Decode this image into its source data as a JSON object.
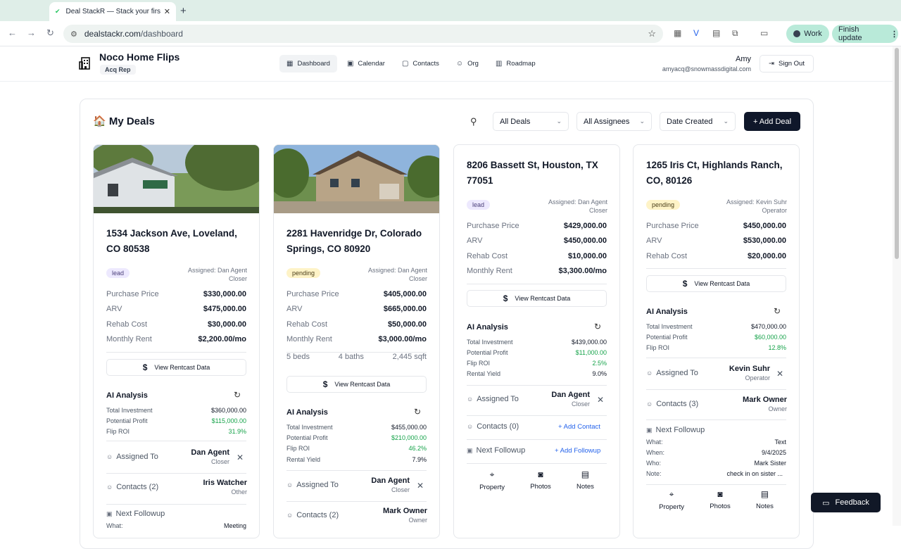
{
  "browser": {
    "tab_title": "Deal StackR — Stack your firs",
    "url_host": "dealstackr.com",
    "url_path": "/dashboard",
    "profile_label": "Work",
    "update_label": "Finish update"
  },
  "app": {
    "company": "Noco Home Flips",
    "role": "Acq Rep",
    "nav": [
      "Dashboard",
      "Calendar",
      "Contacts",
      "Org",
      "Roadmap"
    ],
    "user_name": "Amy",
    "user_email": "amyacq@snowmassdigital.com",
    "sign_out": "Sign Out"
  },
  "deals_header": {
    "title": "🏠 My Deals",
    "filter_deals": "All Deals",
    "filter_assignees": "All Assignees",
    "sort": "Date Created",
    "add_deal": "+ Add Deal"
  },
  "labels": {
    "purchase_price": "Purchase Price",
    "arv": "ARV",
    "rehab_cost": "Rehab Cost",
    "monthly_rent": "Monthly Rent",
    "view_rentcast": "View Rentcast Data",
    "ai_analysis": "AI Analysis",
    "total_investment": "Total Investment",
    "potential_profit": "Potential Profit",
    "flip_roi": "Flip ROI",
    "rental_yield": "Rental Yield",
    "assigned_to": "Assigned To",
    "next_followup": "Next Followup",
    "add_contact": "+ Add Contact",
    "add_followup": "+ Add Followup",
    "what": "What:",
    "when": "When:",
    "who": "Who:",
    "note": "Note:",
    "property": "Property",
    "photos": "Photos",
    "notes": "Notes",
    "feedback": "Feedback"
  },
  "cards": [
    {
      "address": "1534 Jackson Ave, Loveland, CO 80538",
      "status": "lead",
      "assigned_line1": "Assigned: Dan Agent",
      "assigned_line2": "Closer",
      "purchase_price": "$330,000.00",
      "arv": "$475,000.00",
      "rehab_cost": "$30,000.00",
      "monthly_rent": "$2,200.00/mo",
      "total_investment": "$360,000.00",
      "potential_profit": "$115,000.00",
      "flip_roi": "31.9%",
      "assignee_name": "Dan Agent",
      "assignee_role": "Closer",
      "contacts_label": "Contacts (2)",
      "contact_name": "Iris Watcher",
      "contact_role": "Other",
      "followup_what": "Meeting"
    },
    {
      "address": "2281 Havenridge Dr, Colorado Springs, CO 80920",
      "status": "pending",
      "assigned_line1": "Assigned: Dan Agent",
      "assigned_line2": "Closer",
      "purchase_price": "$405,000.00",
      "arv": "$665,000.00",
      "rehab_cost": "$50,000.00",
      "monthly_rent": "$3,000.00/mo",
      "beds": "5 beds",
      "baths": "4 baths",
      "sqft": "2,445 sqft",
      "total_investment": "$455,000.00",
      "potential_profit": "$210,000.00",
      "flip_roi": "46.2%",
      "rental_yield": "7.9%",
      "assignee_name": "Dan Agent",
      "assignee_role": "Closer",
      "contacts_label": "Contacts (2)",
      "contact_name": "Mark Owner",
      "contact_role": "Owner"
    },
    {
      "address": "8206 Bassett St, Houston, TX 77051",
      "status": "lead",
      "assigned_line1": "Assigned: Dan Agent",
      "assigned_line2": "Closer",
      "purchase_price": "$429,000.00",
      "arv": "$450,000.00",
      "rehab_cost": "$10,000.00",
      "monthly_rent": "$3,300.00/mo",
      "total_investment": "$439,000.00",
      "potential_profit": "$11,000.00",
      "flip_roi": "2.5%",
      "rental_yield": "9.0%",
      "assignee_name": "Dan Agent",
      "assignee_role": "Closer",
      "contacts_label": "Contacts (0)"
    },
    {
      "address": "1265 Iris Ct, Highlands Ranch, CO, 80126",
      "status": "pending",
      "assigned_line1": "Assigned: Kevin Suhr",
      "assigned_line2": "Operator",
      "purchase_price": "$450,000.00",
      "arv": "$530,000.00",
      "rehab_cost": "$20,000.00",
      "total_investment": "$470,000.00",
      "potential_profit": "$60,000.00",
      "flip_roi": "12.8%",
      "assignee_name": "Kevin Suhr",
      "assignee_role": "Operator",
      "contacts_label": "Contacts (3)",
      "contact_name": "Mark Owner",
      "contact_role": "Owner",
      "followup_what": "Text",
      "followup_when": "9/4/2025",
      "followup_who": "Mark Sister",
      "followup_note": "check in on sister ..."
    }
  ],
  "icons": {
    "favicon": "check-icon",
    "company_logo": "building-icon",
    "dashboard": "grid-icon",
    "calendar": "calendar-icon",
    "contacts": "contact-card-icon",
    "org": "users-icon",
    "roadmap": "map-icon",
    "sign_out": "logout-icon",
    "search": "search-icon",
    "refresh": "refresh-icon",
    "property": "map-pin-icon",
    "photos": "camera-icon",
    "notes": "document-icon",
    "feedback": "chat-icon"
  },
  "colors": {
    "primary_button": "#0f172a",
    "lead_badge": "#ede9fe",
    "pending_badge": "#fef3c7",
    "profit_green": "#16a34a",
    "link_blue": "#2563eb",
    "browser_accent": "#b9ead9"
  }
}
